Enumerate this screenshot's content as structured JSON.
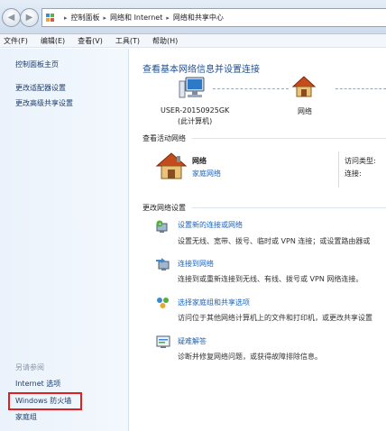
{
  "breadcrumb": [
    "控制面板",
    "网络和 Internet",
    "网络和共享中心"
  ],
  "menu": [
    "文件(F)",
    "编辑(E)",
    "查看(V)",
    "工具(T)",
    "帮助(H)"
  ],
  "left_pane": {
    "links": [
      "控制面板主页",
      "更改适配器设置",
      "更改高级共享设置"
    ],
    "see_also_title": "另请参阅",
    "see_also": [
      "Internet 选项",
      "Windows 防火墙",
      "家庭组"
    ]
  },
  "main": {
    "title": "查看基本网络信息并设置连接",
    "computer_name": "USER-20150925GK",
    "computer_sub": "(此计算机)",
    "network_label": "网络",
    "active_section": "查看活动网络",
    "active_network": {
      "name": "网络",
      "type": "家庭网络",
      "access_type_label": "访问类型:",
      "connection_label": "连接:"
    },
    "change_section": "更改网络设置",
    "tasks": [
      {
        "link": "设置新的连接或网络",
        "desc": "设置无线、宽带、拨号、临时或 VPN 连接；或设置路由器或"
      },
      {
        "link": "连接到网络",
        "desc": "连接到或重新连接到无线、有线、拨号或 VPN 网络连接。"
      },
      {
        "link": "选择家庭组和共享选项",
        "desc": "访问位于其他网络计算机上的文件和打印机，或更改共享设置"
      },
      {
        "link": "疑难解答",
        "desc": "诊断并修复网络问题，或获得故障排除信息。"
      }
    ]
  },
  "icons": {
    "nav_back": "◀",
    "nav_forward": "▶",
    "breadcrumb_separator": "▸",
    "nav_history": "▸"
  },
  "colors": {
    "link": "#1e62b5",
    "title": "#1f4e8c",
    "highlight_box": "#e02020"
  }
}
